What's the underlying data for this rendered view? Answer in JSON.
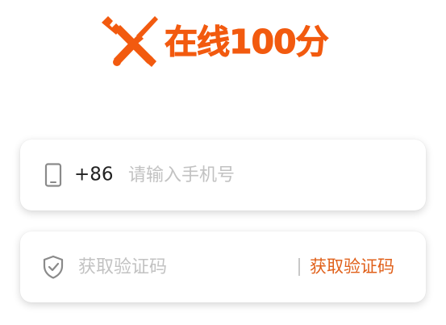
{
  "colors": {
    "brand": "#f25a0f",
    "accent_text": "#e0601a",
    "icon_gray": "#8a8a8a",
    "text_dark": "#222222",
    "placeholder": "#c2c2c2"
  },
  "logo": {
    "icon": "wrench-screwdriver-icon",
    "text": "在线100分"
  },
  "phone_field": {
    "icon": "phone-icon",
    "country_code": "+86",
    "placeholder": "请输入手机号",
    "value": ""
  },
  "code_field": {
    "icon": "shield-check-icon",
    "placeholder": "获取验证码",
    "value": "",
    "button_label": "获取验证码"
  }
}
